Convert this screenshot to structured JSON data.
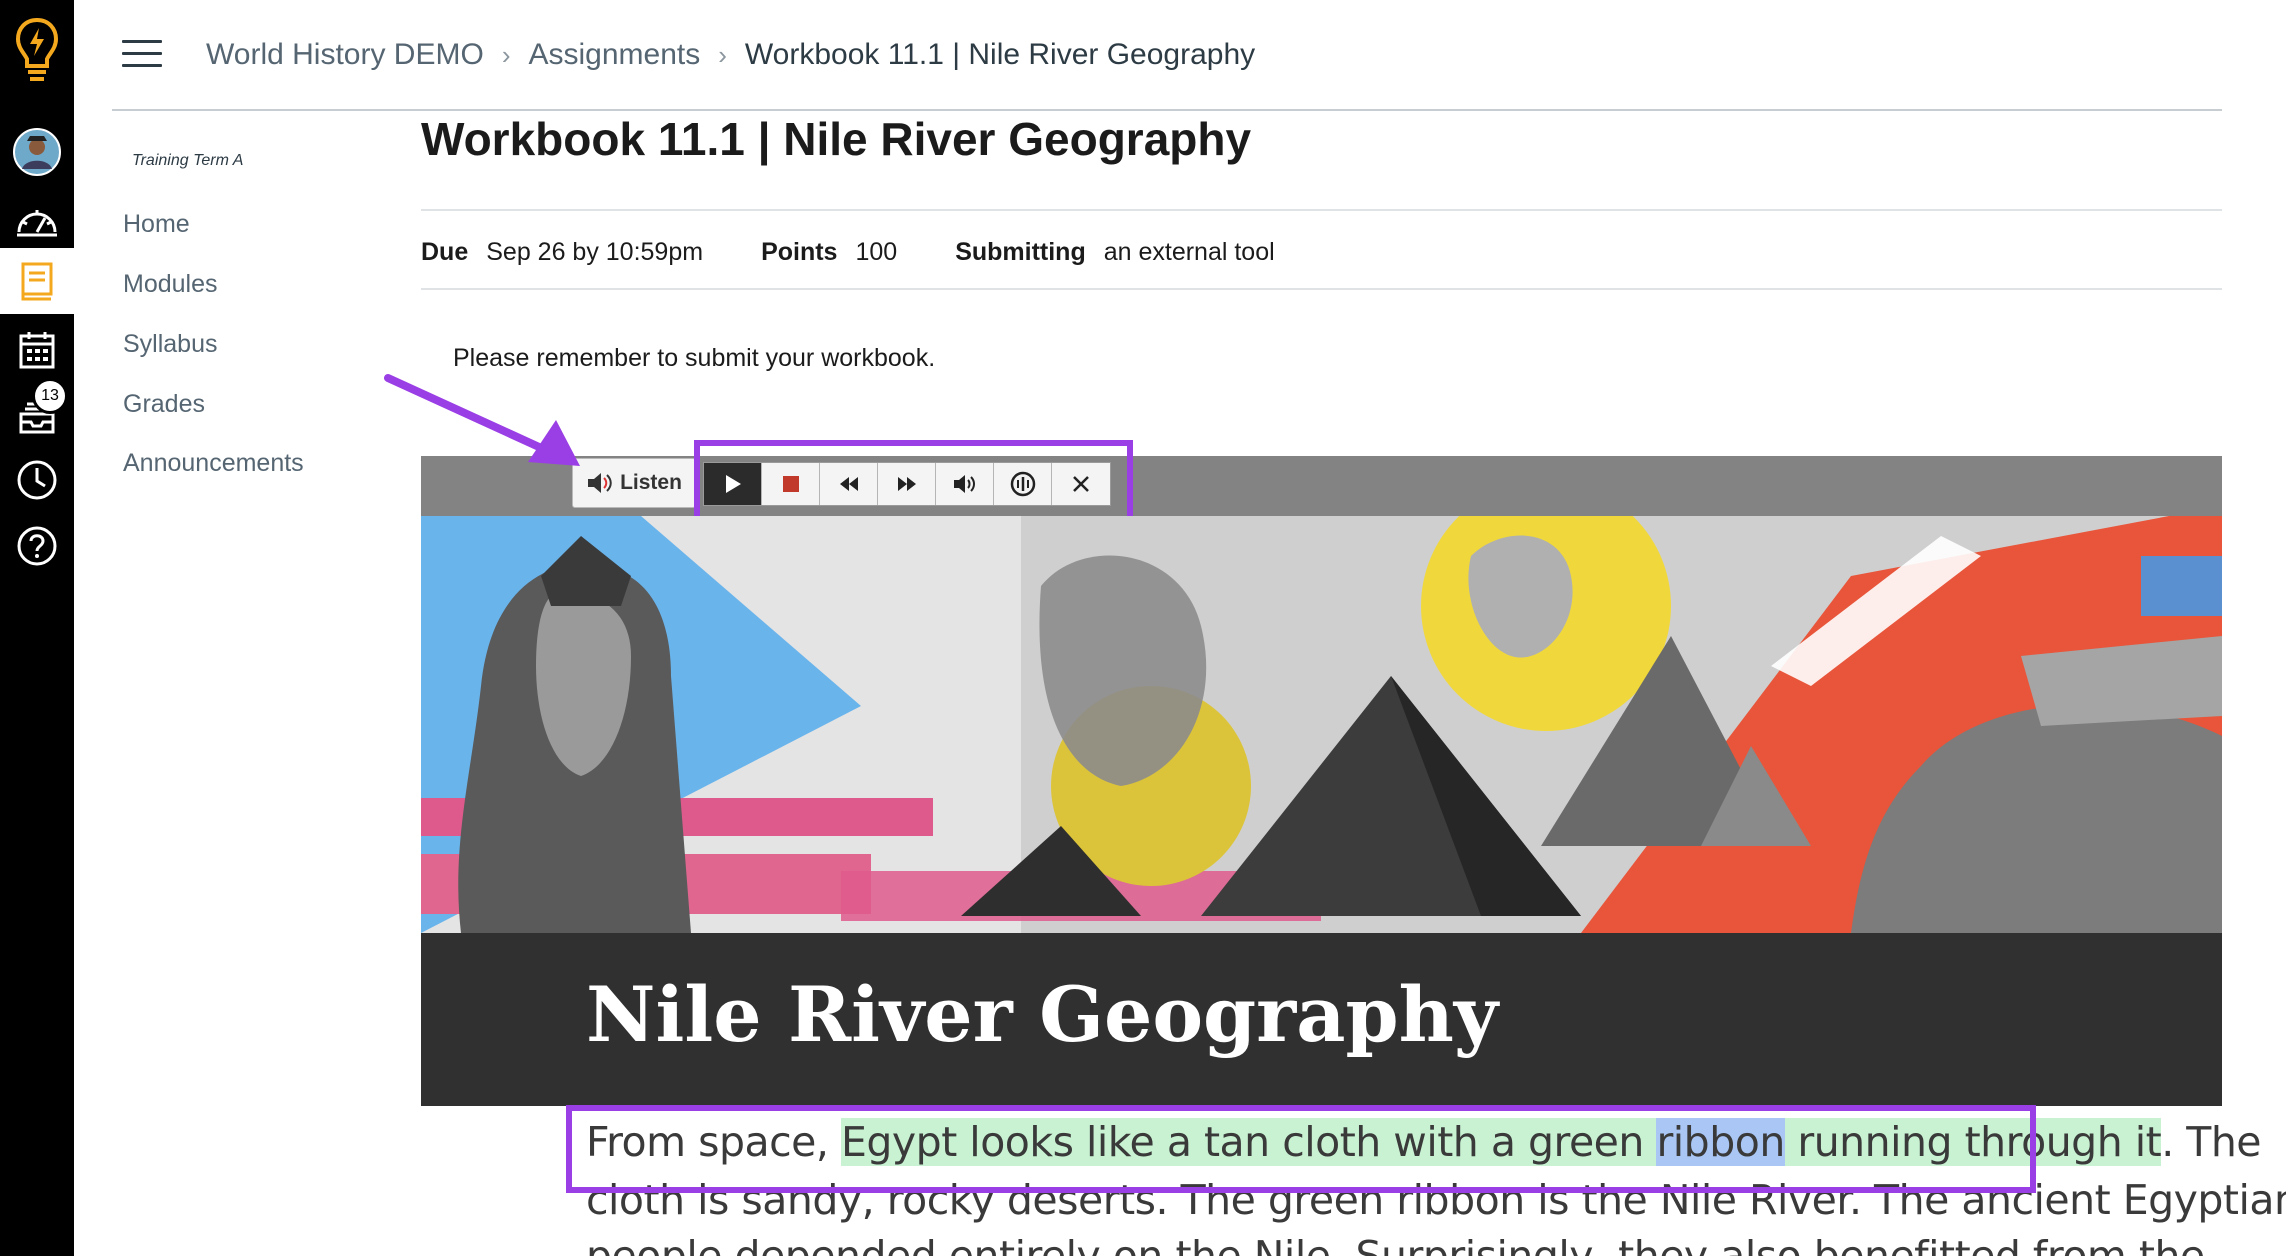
{
  "breadcrumb": {
    "course": "World History DEMO",
    "section": "Assignments",
    "current": "Workbook 11.1 | Nile River Geography"
  },
  "global_nav": {
    "inbox_badge": "13",
    "icons": [
      "lightbulb-logo-icon",
      "account-avatar",
      "dashboard-icon",
      "courses-icon",
      "calendar-icon",
      "inbox-icon",
      "history-icon",
      "help-icon"
    ]
  },
  "course_nav": {
    "term": "Training Term A",
    "items": [
      "Home",
      "Modules",
      "Syllabus",
      "Grades",
      "Announcements"
    ]
  },
  "assignment": {
    "title": "Workbook 11.1 | Nile River Geography",
    "due_label": "Due",
    "due_value": "Sep 26 by 10:59pm",
    "points_label": "Points",
    "points_value": "100",
    "submitting_label": "Submitting",
    "submitting_value": "an external tool",
    "note": "Please remember to submit your workbook."
  },
  "listen_toolbar": {
    "listen_label": "Listen",
    "controls": [
      "play-icon",
      "stop-icon",
      "rewind-icon",
      "fast-forward-icon",
      "volume-icon",
      "settings-icon",
      "close-icon"
    ]
  },
  "banner": {
    "title": "Nile River Geography"
  },
  "body": {
    "l1_pre": "From space, ",
    "l1_hl_a": "Egypt looks like a tan cloth with a green ",
    "l1_hl_word": "ribbon",
    "l1_hl_b": " running through it",
    "l1_post": ". The",
    "l2": "cloth is sandy, rocky deserts. The green ribbon is the Nile River. The ancient Egyptian",
    "l3": "people depended entirely on the Nile. Surprisingly, they also benefitted from the"
  },
  "colors": {
    "annotation": "#9a3ee5",
    "highlight_sentence": "#c8f2d2",
    "highlight_word": "#a9c6f5",
    "active_nav": "#f4a81d"
  }
}
